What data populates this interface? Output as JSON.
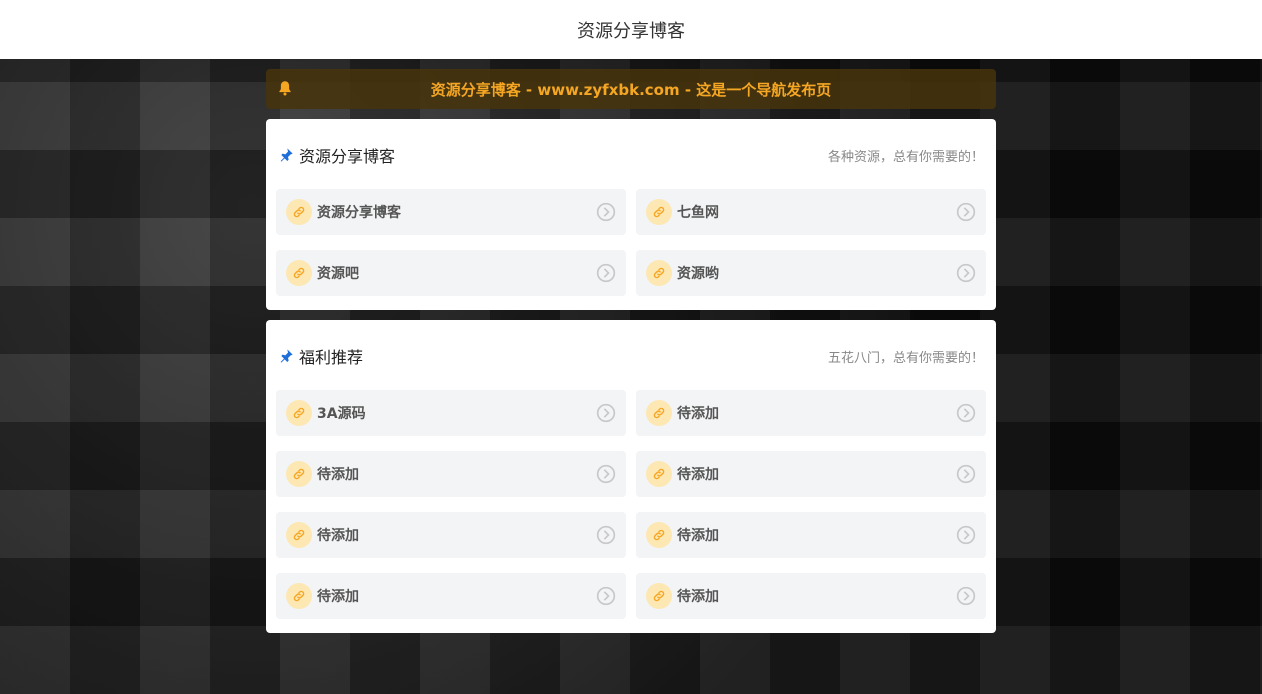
{
  "header": {
    "title": "资源分享博客"
  },
  "notice": {
    "text": "资源分享博客 - www.zyfxbk.com - 这是一个导航发布页"
  },
  "sections": [
    {
      "title": "资源分享博客",
      "desc": "各种资源，总有你需要的！",
      "items": [
        "资源分享博客",
        "七鱼网",
        "资源吧",
        "资源哟"
      ]
    },
    {
      "title": "福利推荐",
      "desc": "五花八门，总有你需要的！",
      "items": [
        "3A源码",
        "待添加",
        "待添加",
        "待添加",
        "待添加",
        "待添加",
        "待添加",
        "待添加"
      ]
    }
  ],
  "colors": {
    "accent": "#f5a623",
    "pin": "#1e6fd9",
    "badge": "#fde7b3"
  },
  "icons": {
    "notice": "bell-icon",
    "section": "pin-icon",
    "item": "link-icon",
    "go": "chevron-right-circle-icon"
  }
}
